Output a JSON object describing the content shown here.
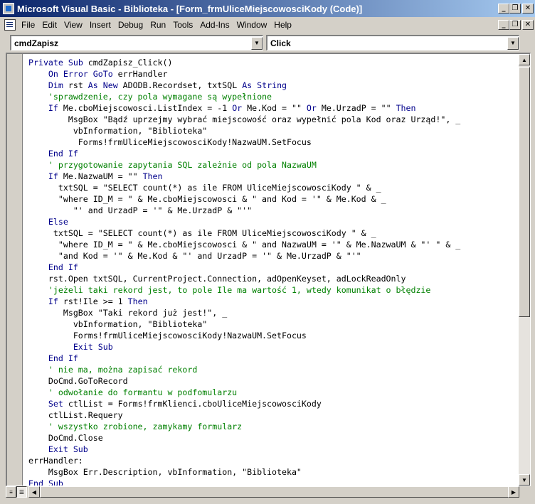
{
  "window": {
    "title": "Microsoft Visual Basic - Biblioteka - [Form_frmUliceMiejscowosciKody (Code)]",
    "controls": {
      "minimize": "_",
      "restore": "❐",
      "close": "✕"
    }
  },
  "menu": {
    "items": [
      "File",
      "Edit",
      "View",
      "Insert",
      "Debug",
      "Run",
      "Tools",
      "Add-Ins",
      "Window",
      "Help"
    ]
  },
  "doc_controls": {
    "minimize": "_",
    "restore": "❐",
    "close": "✕"
  },
  "object_combo": {
    "value": "cmdZapisz"
  },
  "procedure_combo": {
    "value": "Click"
  },
  "code_lines": [
    "Private Sub cmdZapisz_Click()",
    "    On Error GoTo errHandler",
    "    Dim rst As New ADODB.Recordset, txtSQL As String",
    "    'sprawdzenie, czy pola wymagane są wypełnione",
    "    If Me.cboMiejscowosci.ListIndex = -1 Or Me.Kod = \"\" Or Me.UrzadP = \"\" Then",
    "        MsgBox \"Bądź uprzejmy wybrać miejscowość oraz wypełnić pola Kod oraz Urząd!\", _",
    "         vbInformation, \"Biblioteka\"",
    "          Forms!frmUliceMiejscowosciKody!NazwaUM.SetFocus",
    "    End If",
    "    ' przygotowanie zapytania SQL zależnie od pola NazwaUM",
    "    If Me.NazwaUM = \"\" Then",
    "      txtSQL = \"SELECT count(*) as ile FROM UliceMiejscowosciKody \" & _",
    "      \"where ID_M = \" & Me.cboMiejscowosci & \" and Kod = '\" & Me.Kod & _",
    "         \"' and UrzadP = '\" & Me.UrzadP & \"'\"",
    "    Else",
    "     txtSQL = \"SELECT count(*) as ile FROM UliceMiejscowosciKody \" & _",
    "      \"where ID_M = \" & Me.cboMiejscowosci & \" and NazwaUM = '\" & Me.NazwaUM & \"' \" & _",
    "      \"and Kod = '\" & Me.Kod & \"' and UrzadP = '\" & Me.UrzadP & \"'\"",
    "    End If",
    "    rst.Open txtSQL, CurrentProject.Connection, adOpenKeyset, adLockReadOnly",
    "    'jeżeli taki rekord jest, to pole Ile ma wartość 1, wtedy komunikat o błędzie",
    "    If rst!Ile >= 1 Then",
    "       MsgBox \"Taki rekord już jest!\", _",
    "         vbInformation, \"Biblioteka\"",
    "         Forms!frmUliceMiejscowosciKody!NazwaUM.SetFocus",
    "         Exit Sub",
    "    End If",
    "    ' nie ma, można zapisać rekord",
    "    DoCmd.GoToRecord",
    "    ' odwołanie do formantu w podfomularzu",
    "    Set ctlList = Forms!frmKlienci.cboUliceMiejscowosciKody",
    "    ctlList.Requery",
    "    ' wszystko zrobione, zamykamy formularz",
    "    DoCmd.Close",
    "    Exit Sub",
    "errHandler:",
    "    MsgBox Err.Description, vbInformation, \"Biblioteka\"",
    "End Sub"
  ],
  "colors": {
    "keyword": "#00008b",
    "comment": "#008000",
    "titlebar": "#0a246a"
  },
  "icons": {
    "app": "vb-app-icon",
    "doc": "code-window-icon"
  }
}
